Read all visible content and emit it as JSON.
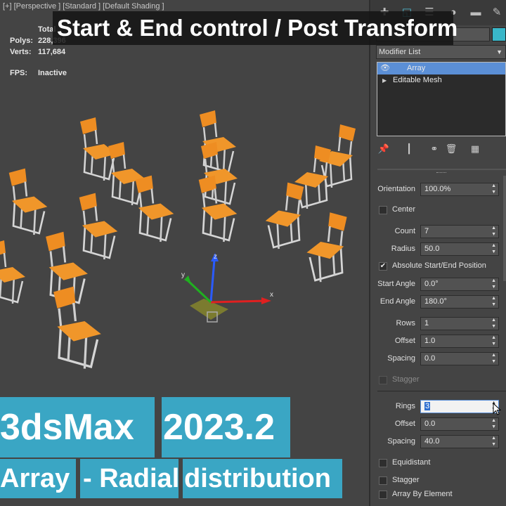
{
  "viewport": {
    "label": "[+] [Perspective ] [Standard ] [Default Shading ]",
    "stats": [
      {
        "key": "Polys:",
        "value": "228,396"
      },
      {
        "key": "Verts:",
        "value": "117,684"
      }
    ],
    "total_label": "Total",
    "fps_key": "FPS:",
    "fps_value": "Inactive",
    "gizmo_axes": [
      "x",
      "y",
      "z"
    ]
  },
  "title": "Start & End control / Post Transform",
  "captions": {
    "line1_a": "3dsMax",
    "line1_b": "2023.2",
    "line2_a": "Array",
    "line2_b": "- Radial",
    "line2_c": "distribution"
  },
  "panel": {
    "modifier_list": "Modifier List",
    "stack": [
      {
        "label": "Array",
        "selected": true
      },
      {
        "label": "Editable Mesh",
        "selected": false
      }
    ],
    "params": {
      "orientation": {
        "label": "Orientation",
        "value": "100.0%"
      },
      "center": {
        "label": "Center",
        "checked": false
      },
      "count": {
        "label": "Count",
        "value": "7"
      },
      "radius": {
        "label": "Radius",
        "value": "50.0"
      },
      "abs_start_end": {
        "label": "Absolute Start/End Position",
        "checked": true
      },
      "start_angle": {
        "label": "Start Angle",
        "value": "0.0°"
      },
      "end_angle": {
        "label": "End Angle",
        "value": "180.0°"
      },
      "rows": {
        "label": "Rows",
        "value": "1"
      },
      "offset1": {
        "label": "Offset",
        "value": "1.0"
      },
      "spacing1": {
        "label": "Spacing",
        "value": "0.0"
      },
      "stagger1": {
        "label": "Stagger",
        "checked": false
      },
      "rings": {
        "label": "Rings",
        "value": "3"
      },
      "offset2": {
        "label": "Offset",
        "value": "0.0"
      },
      "spacing2": {
        "label": "Spacing",
        "value": "40.0"
      },
      "equidistant": {
        "label": "Equidistant",
        "checked": false
      },
      "stagger2": {
        "label": "Stagger",
        "checked": false
      },
      "array_by_element": {
        "label": "Array By Element",
        "checked": false
      }
    }
  },
  "colors": {
    "accent_caption": "#3aa6c4",
    "chair_seat": "#f0962a",
    "object_color": "#39b7c9",
    "selected_stack": "#5b8fd6"
  }
}
